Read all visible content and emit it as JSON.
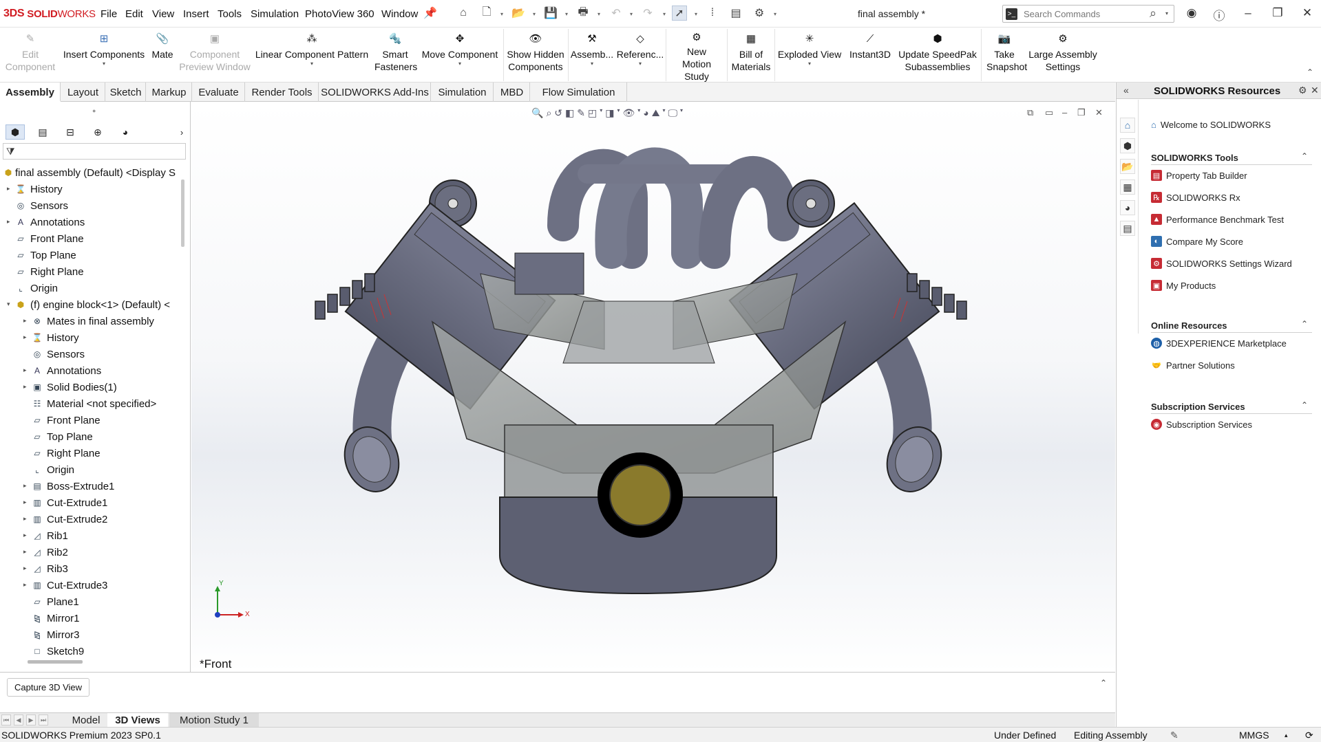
{
  "app": {
    "brand_prefix": "3DS",
    "brand_bold": "SOLID",
    "brand_light": "WORKS",
    "doc_title": "final assembly *"
  },
  "menu": [
    "File",
    "Edit",
    "View",
    "Insert",
    "Tools",
    "Simulation",
    "PhotoView 360",
    "Window"
  ],
  "search": {
    "placeholder": "Search Commands"
  },
  "commands": [
    {
      "label": "Edit Component",
      "disabled": true
    },
    {
      "label": "Insert Components",
      "disabled": false
    },
    {
      "label": "Mate",
      "disabled": false
    },
    {
      "label": "Component Preview Window",
      "disabled": true
    },
    {
      "label": "Linear Component Pattern",
      "disabled": false
    },
    {
      "label": "Smart Fasteners",
      "disabled": false
    },
    {
      "label": "Move Component",
      "disabled": false
    },
    {
      "label": "Show Hidden Components",
      "disabled": false
    },
    {
      "label": "Assemb...",
      "disabled": false
    },
    {
      "label": "Referenc...",
      "disabled": false
    },
    {
      "label": "New Motion Study",
      "disabled": false
    },
    {
      "label": "Bill of Materials",
      "disabled": false
    },
    {
      "label": "Exploded View",
      "disabled": false
    },
    {
      "label": "Instant3D",
      "disabled": false
    },
    {
      "label": "Update SpeedPak Subassemblies",
      "disabled": false
    },
    {
      "label": "Take Snapshot",
      "disabled": false
    },
    {
      "label": "Large Assembly Settings",
      "disabled": false
    }
  ],
  "tabs": [
    "Assembly",
    "Layout",
    "Sketch",
    "Markup",
    "Evaluate",
    "Render Tools",
    "SOLIDWORKS Add-Ins",
    "Simulation",
    "MBD",
    "Flow Simulation"
  ],
  "active_tab": "Assembly",
  "tree": [
    {
      "label": "final assembly (Default) <Display S",
      "level": 0,
      "expand": "",
      "icon": "assembly-icon"
    },
    {
      "label": "History",
      "level": 1,
      "expand": "▸",
      "icon": "history-icon"
    },
    {
      "label": "Sensors",
      "level": 1,
      "expand": "",
      "icon": "sensor-icon"
    },
    {
      "label": "Annotations",
      "level": 1,
      "expand": "▸",
      "icon": "annotation-icon"
    },
    {
      "label": "Front Plane",
      "level": 1,
      "expand": "",
      "icon": "plane-icon"
    },
    {
      "label": "Top Plane",
      "level": 1,
      "expand": "",
      "icon": "plane-icon"
    },
    {
      "label": "Right Plane",
      "level": 1,
      "expand": "",
      "icon": "plane-icon"
    },
    {
      "label": "Origin",
      "level": 1,
      "expand": "",
      "icon": "origin-icon"
    },
    {
      "label": "(f) engine block<1> (Default) <",
      "level": 1,
      "expand": "▾",
      "icon": "part-icon"
    },
    {
      "label": "Mates in final assembly",
      "level": 2,
      "expand": "▸",
      "icon": "mates-icon"
    },
    {
      "label": "History",
      "level": 2,
      "expand": "▸",
      "icon": "history-icon"
    },
    {
      "label": "Sensors",
      "level": 2,
      "expand": "",
      "icon": "sensor-icon"
    },
    {
      "label": "Annotations",
      "level": 2,
      "expand": "▸",
      "icon": "annotation-icon"
    },
    {
      "label": "Solid Bodies(1)",
      "level": 2,
      "expand": "▸",
      "icon": "solid-bodies-icon"
    },
    {
      "label": "Material <not specified>",
      "level": 2,
      "expand": "",
      "icon": "material-icon"
    },
    {
      "label": "Front Plane",
      "level": 2,
      "expand": "",
      "icon": "plane-icon"
    },
    {
      "label": "Top Plane",
      "level": 2,
      "expand": "",
      "icon": "plane-icon"
    },
    {
      "label": "Right Plane",
      "level": 2,
      "expand": "",
      "icon": "plane-icon"
    },
    {
      "label": "Origin",
      "level": 2,
      "expand": "",
      "icon": "origin-icon"
    },
    {
      "label": "Boss-Extrude1",
      "level": 2,
      "expand": "▸",
      "icon": "extrude-icon"
    },
    {
      "label": "Cut-Extrude1",
      "level": 2,
      "expand": "▸",
      "icon": "cut-icon"
    },
    {
      "label": "Cut-Extrude2",
      "level": 2,
      "expand": "▸",
      "icon": "cut-icon"
    },
    {
      "label": "Rib1",
      "level": 2,
      "expand": "▸",
      "icon": "rib-icon"
    },
    {
      "label": "Rib2",
      "level": 2,
      "expand": "▸",
      "icon": "rib-icon"
    },
    {
      "label": "Rib3",
      "level": 2,
      "expand": "▸",
      "icon": "rib-icon"
    },
    {
      "label": "Cut-Extrude3",
      "level": 2,
      "expand": "▸",
      "icon": "cut-icon"
    },
    {
      "label": "Plane1",
      "level": 2,
      "expand": "",
      "icon": "plane-icon"
    },
    {
      "label": "Mirror1",
      "level": 2,
      "expand": "",
      "icon": "mirror-icon"
    },
    {
      "label": "Mirror3",
      "level": 2,
      "expand": "",
      "icon": "mirror-icon"
    },
    {
      "label": "Sketch9",
      "level": 2,
      "expand": "",
      "icon": "sketch-icon"
    }
  ],
  "viewport": {
    "view_label": "*Front",
    "triad_y": "Y",
    "triad_x": "X"
  },
  "resources": {
    "title": "SOLIDWORKS Resources",
    "welcome": "Welcome to SOLIDWORKS",
    "sections": [
      {
        "title": "SOLIDWORKS Tools",
        "items": [
          "Property Tab Builder",
          "SOLIDWORKS Rx",
          "Performance Benchmark Test",
          "Compare My Score",
          "SOLIDWORKS Settings Wizard",
          "My Products"
        ]
      },
      {
        "title": "Online Resources",
        "items": [
          "3DEXPERIENCE Marketplace",
          "Partner Solutions"
        ]
      },
      {
        "title": "Subscription Services",
        "items": [
          "Subscription Services"
        ]
      }
    ]
  },
  "bottom": {
    "capture_button": "Capture 3D View",
    "tabs": [
      "Model",
      "3D Views",
      "Motion Study 1"
    ],
    "active_tab": "3D Views"
  },
  "status": {
    "product": "SOLIDWORKS Premium 2023 SP0.1",
    "state": "Under Defined",
    "mode": "Editing Assembly",
    "units": "MMGS"
  },
  "colors": {
    "brand": "#d11c22",
    "part_gray": "#6b6e80",
    "bearing": "#8a7a2c"
  }
}
